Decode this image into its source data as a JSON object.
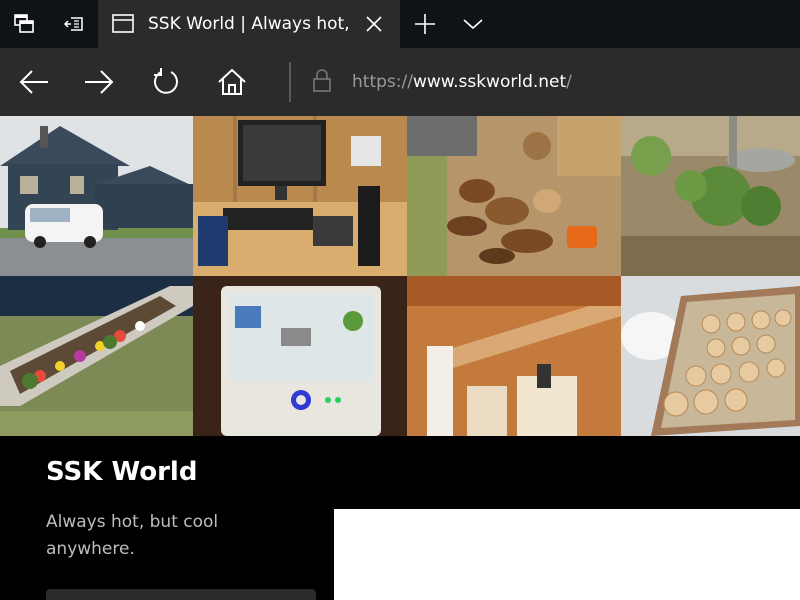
{
  "browser": {
    "tab": {
      "title": "SSK World | Always hot, but cool anywhere."
    },
    "address": {
      "scheme": "https://",
      "host": "www.sskworld.net",
      "path": "/"
    },
    "icons": {
      "tab_actions": "tab-actions-icon",
      "set_aside": "set-aside-tabs-icon",
      "page": "page-icon",
      "close": "close-icon",
      "new_tab": "plus-icon",
      "tab_preview": "chevron-down-icon",
      "back": "back-arrow-icon",
      "forward": "forward-arrow-icon",
      "refresh": "refresh-icon",
      "home": "home-icon",
      "lock": "lock-icon"
    }
  },
  "site": {
    "title": "SSK World",
    "tagline": "Always hot, but cool anywhere.",
    "accent": "#000000"
  }
}
